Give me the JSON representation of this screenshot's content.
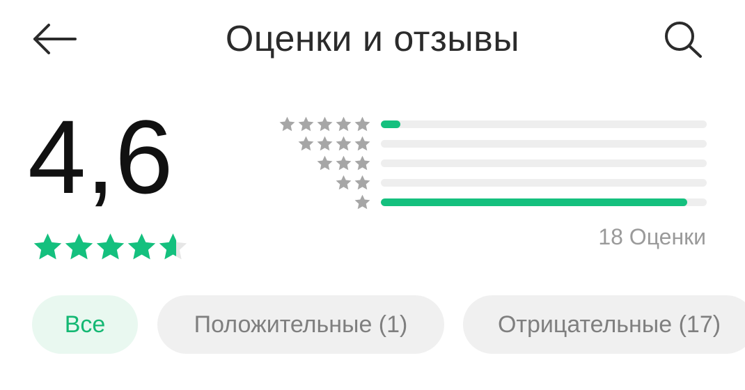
{
  "header": {
    "title": "Оценки и отзывы",
    "back_icon": "arrow-left-icon",
    "search_icon": "search-icon"
  },
  "rating": {
    "score": "4,6",
    "stars_value": 4.6,
    "stars_max": 5,
    "count_label": "18 Оценки"
  },
  "histogram": [
    {
      "stars": 5,
      "fraction": 0.06
    },
    {
      "stars": 4,
      "fraction": 0.0
    },
    {
      "stars": 3,
      "fraction": 0.0
    },
    {
      "stars": 2,
      "fraction": 0.0
    },
    {
      "stars": 1,
      "fraction": 0.94
    }
  ],
  "filters": {
    "all": "Все",
    "positive": "Положительные (1)",
    "negative": "Отрицательные (17)"
  },
  "colors": {
    "accent": "#14c07e",
    "star_inactive": "#a6a6a6",
    "track": "#eeeeee",
    "chip_active_bg": "#e9f8f0",
    "chip_bg": "#f0f0f0"
  }
}
